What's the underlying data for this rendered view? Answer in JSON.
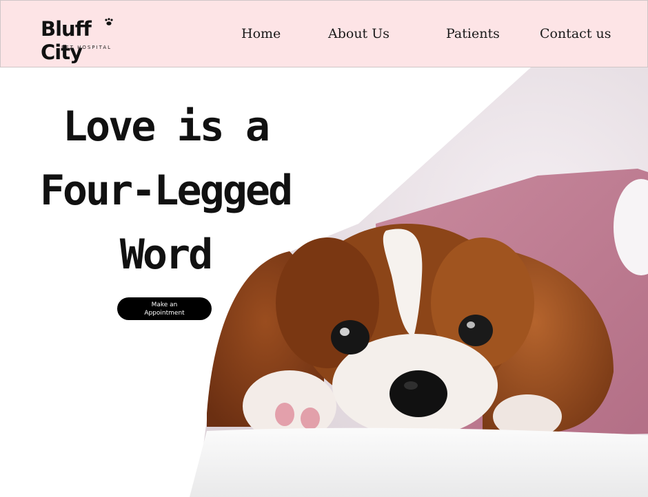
{
  "brand": {
    "name": "Bluff City",
    "tagline": "PET HOSPITAL"
  },
  "nav": [
    {
      "label": "Home"
    },
    {
      "label": "About Us"
    },
    {
      "label": "Patients"
    },
    {
      "label": "Contact us"
    }
  ],
  "hero": {
    "headline_lines": [
      "Love is a",
      "Four-Legged",
      "Word"
    ],
    "cta_lines": [
      "Make an",
      "Appointment"
    ],
    "image_icon": "puppy-photo"
  },
  "colors": {
    "header_bg": "#fde4e6",
    "cta_bg": "#000000",
    "text": "#111111"
  }
}
